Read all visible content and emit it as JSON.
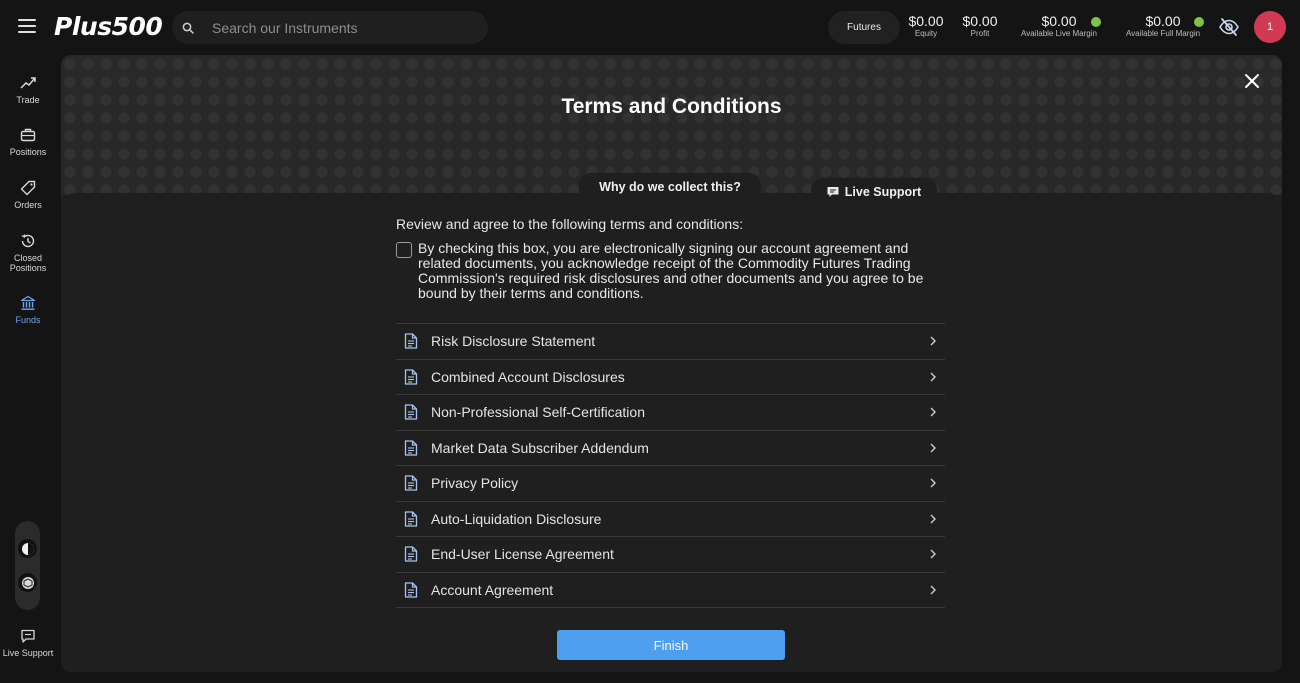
{
  "header": {
    "logo": "Plus500",
    "search": {
      "placeholder": "Search our Instruments",
      "value": ""
    },
    "futures_button": "Futures",
    "metrics": [
      {
        "value": "$0.00",
        "label": "Equity"
      },
      {
        "value": "$0.00",
        "label": "Profit"
      },
      {
        "value": "$0.00",
        "label": "Available Live Margin"
      },
      {
        "value": "$0.00",
        "label": "Available Full Margin"
      }
    ],
    "avatar_initial": "1",
    "colors": {
      "accent": "#4e9fef",
      "avatar": "#d13a52",
      "status_green": "#7dc24b"
    }
  },
  "sidebar": {
    "items": [
      {
        "label": "Trade",
        "icon": "trend-line-icon"
      },
      {
        "label": "Positions",
        "icon": "briefcase-icon"
      },
      {
        "label": "Orders",
        "icon": "tag-icon"
      },
      {
        "label": "Closed Positions",
        "icon": "history-clock-icon"
      },
      {
        "label": "Funds",
        "icon": "bank-icon"
      }
    ],
    "live_support": "Live Support"
  },
  "modal": {
    "title": "Terms and Conditions",
    "why_tab": "Why do we collect this?",
    "live_support": "Live Support",
    "intro": "Review and agree to the following terms and conditions:",
    "agree_text": "By checking this box, you are electronically signing our account agreement and related documents, you acknowledge receipt of the Commodity Futures Trading Commission's required risk disclosures and other documents and you agree to be bound by their terms and conditions.",
    "agree_checked": false,
    "documents": [
      "Risk Disclosure Statement",
      "Combined Account Disclosures",
      "Non-Professional Self-Certification",
      "Market Data Subscriber Addendum",
      "Privacy Policy",
      "Auto-Liquidation Disclosure",
      "End-User License Agreement",
      "Account Agreement"
    ],
    "finish_button": "Finish"
  }
}
